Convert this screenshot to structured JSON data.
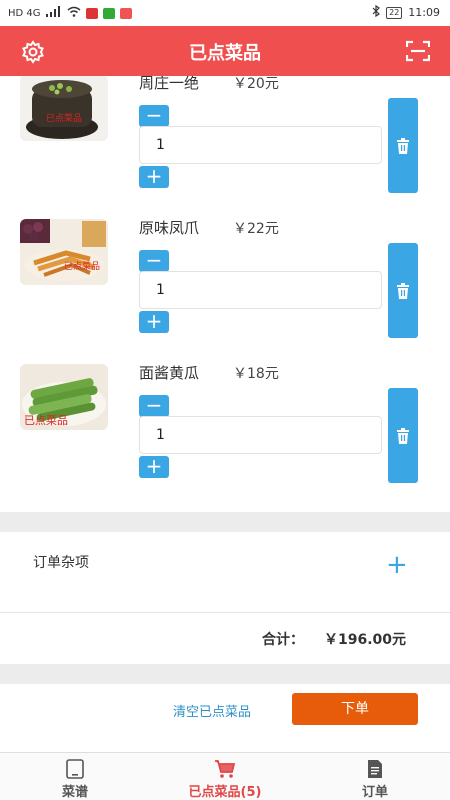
{
  "status_bar": {
    "left_text": "HD 4G",
    "battery": "22",
    "time": "11:09"
  },
  "header": {
    "title": "已点菜品",
    "settings_icon": "gear-icon",
    "scan_icon": "scan-icon",
    "bg_color": "#ef4f4e"
  },
  "dishes": [
    {
      "name": "周庄一绝",
      "price": "￥20元",
      "quantity": "1",
      "minus": "−",
      "plus": "+"
    },
    {
      "name": "原味凤爪",
      "price": "￥22元",
      "quantity": "1",
      "minus": "−",
      "plus": "+"
    },
    {
      "name": "面酱黄瓜",
      "price": "￥18元",
      "quantity": "1",
      "minus": "−",
      "plus": "+"
    }
  ],
  "misc": {
    "label": "订单杂项",
    "add": "+"
  },
  "summary": {
    "total_label": "合计：",
    "total_value": "￥196.00元"
  },
  "actions": {
    "clear_label": "清空已点菜品",
    "order_label": "下单",
    "order_color": "#e65c0b"
  },
  "tabs": [
    {
      "label": "菜谱",
      "icon": "tablet-icon"
    },
    {
      "label": "已点菜品(5)",
      "icon": "cart-icon",
      "active": true
    },
    {
      "label": "订单",
      "icon": "document-icon"
    }
  ],
  "accent_color": "#3aa6e3"
}
